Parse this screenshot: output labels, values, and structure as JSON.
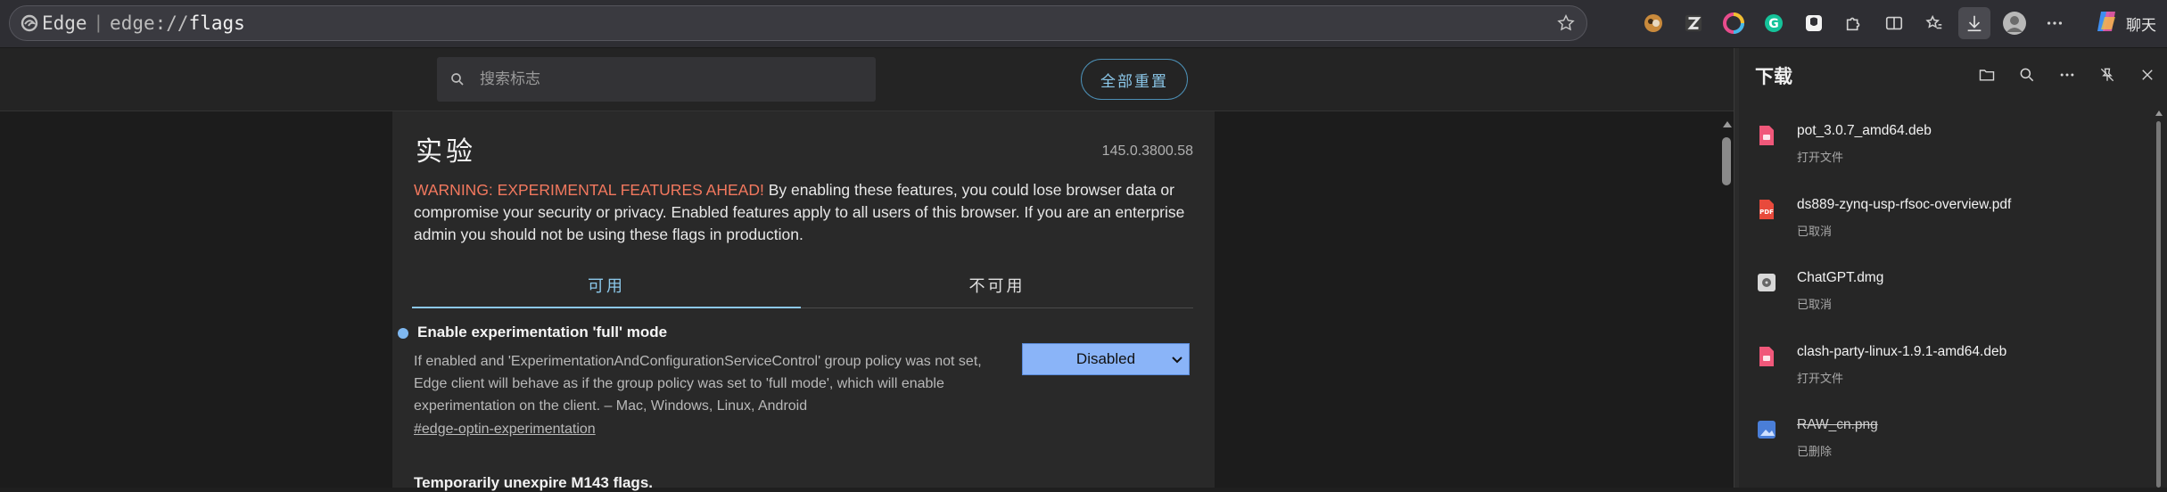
{
  "address_bar": {
    "site_name": "Edge",
    "separator": "|",
    "url_scheme": "edge://",
    "url_path": "flags"
  },
  "toolbar": {
    "icons": [
      "extension-avatar-icon",
      "zotero-icon",
      "color-wheel-icon",
      "grammarly-icon",
      "brave-lion-icon",
      "extensions-puzzle-icon",
      "split-screen-icon",
      "favorites-icon",
      "downloads-icon",
      "profile-avatar-icon",
      "more-menu-icon"
    ],
    "chat_label": "聊天"
  },
  "flags_page": {
    "search_placeholder": "搜索标志",
    "reset_all_label": "全部重置",
    "heading": "实验",
    "version": "145.0.3800.58",
    "warning_prefix": "WARNING: EXPERIMENTAL FEATURES AHEAD!",
    "warning_body": " By enabling these features, you could lose browser data or compromise your security or privacy. Enabled features apply to all users of this browser. If you are an enterprise admin you should not be using these flags in production.",
    "tabs": [
      {
        "label": "可用",
        "active": true
      },
      {
        "label": "不可用",
        "active": false
      }
    ],
    "flags": [
      {
        "title": "Enable experimentation 'full' mode",
        "description": "If enabled and 'ExperimentationAndConfigurationServiceControl' group policy was not set, Edge client will behave as if the group policy was set to 'full mode', which will enable experimentation on the client. – Mac, Windows, Linux, Android",
        "link": "#edge-optin-experimentation",
        "value": "Disabled"
      },
      {
        "title": "Temporarily unexpire M143 flags."
      }
    ]
  },
  "downloads_panel": {
    "title": "下载",
    "tools": [
      "folder-icon",
      "search-icon",
      "more-icon",
      "unpin-icon",
      "close-icon"
    ],
    "items": [
      {
        "name": "pot_3.0.7_amd64.deb",
        "status": "打开文件",
        "icon": "deb-file-icon",
        "strikethrough": false
      },
      {
        "name": "ds889-zynq-usp-rfsoc-overview.pdf",
        "status": "已取消",
        "icon": "pdf-file-icon",
        "strikethrough": false
      },
      {
        "name": "ChatGPT.dmg",
        "status": "已取消",
        "icon": "disk-image-icon",
        "strikethrough": false
      },
      {
        "name": "clash-party-linux-1.9.1-amd64.deb",
        "status": "打开文件",
        "icon": "deb-file-icon",
        "strikethrough": false
      },
      {
        "name": "RAW_cn.png",
        "status": "已删除",
        "icon": "image-file-icon",
        "strikethrough": true
      }
    ]
  },
  "colors": {
    "accent_blue": "#8cc8ea",
    "warning_red": "#f2785e",
    "select_bg": "#8ab4f8",
    "file_icon_pink": "#f0587a"
  }
}
